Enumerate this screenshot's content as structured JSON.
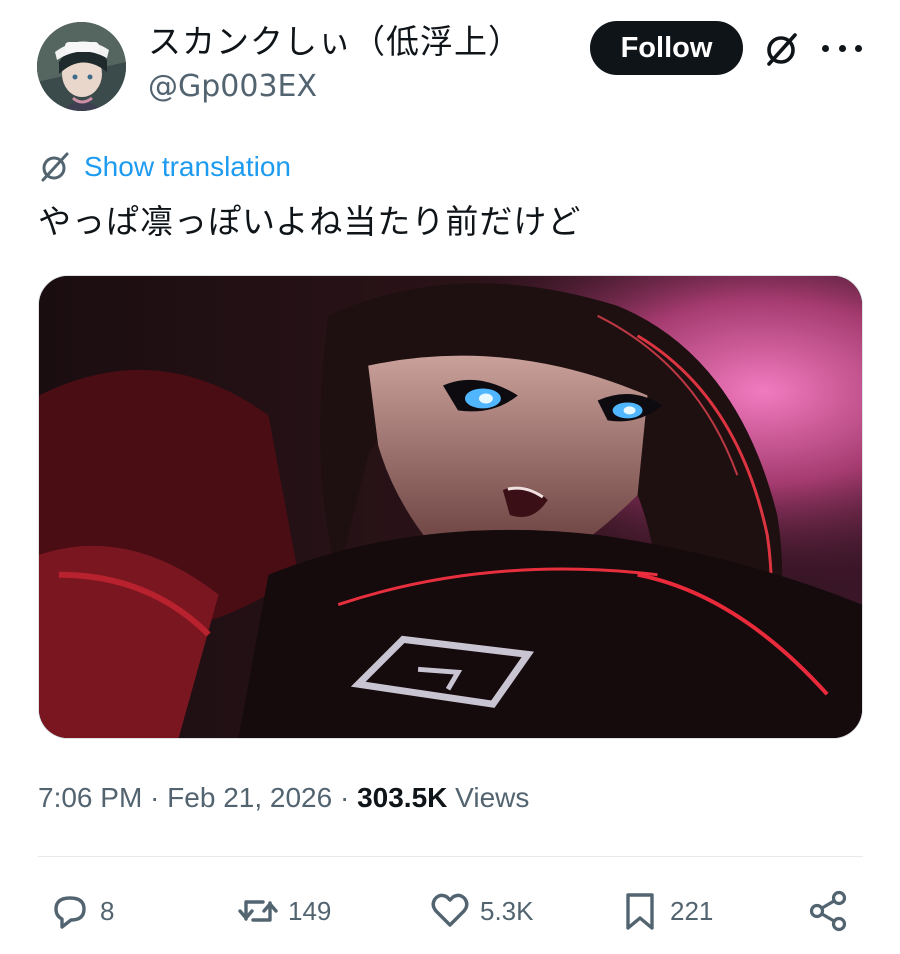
{
  "author": {
    "display_name": "スカンクしぃ（低浮上）",
    "handle": "@Gp003EX"
  },
  "header_actions": {
    "follow_label": "Follow",
    "grok_icon": "grok-icon",
    "more_icon": "more-horizontal-icon"
  },
  "translation": {
    "label": "Show translation",
    "icon": "translate-icon",
    "color": "#1d9bf0"
  },
  "tweet": {
    "text": "やっぱ凛っぽいよね当たり前だけど"
  },
  "meta": {
    "time": "7:06 PM",
    "separator": " · ",
    "date": "Feb 21, 2026",
    "views_count": "303.5K",
    "views_label": "Views"
  },
  "actions": {
    "replies": "8",
    "reposts": "149",
    "likes": "5.3K",
    "bookmarks": "221"
  },
  "colors": {
    "text_primary": "#0f1419",
    "text_secondary": "#536471",
    "accent": "#1d9bf0",
    "follow_bg": "#0f1419"
  }
}
